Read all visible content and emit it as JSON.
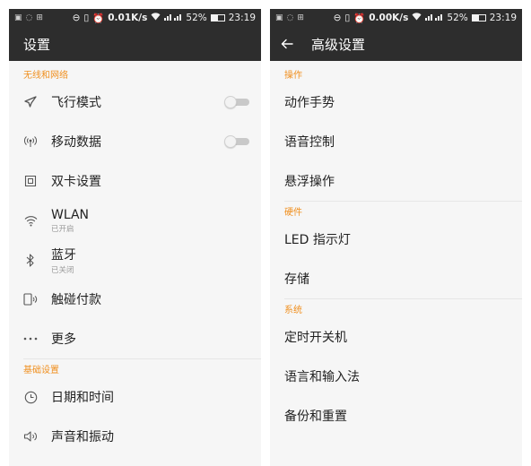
{
  "left": {
    "status": {
      "speed": "0.01K/s",
      "battery": "52%",
      "time": "23:19",
      "battery_level": 0.52
    },
    "title": "设置",
    "sections": {
      "wireless": {
        "header": "无线和网络"
      },
      "basic": {
        "header": "基础设置"
      }
    },
    "items": {
      "airplane": {
        "label": "飞行模式",
        "toggle_on": false
      },
      "mobile_data": {
        "label": "移动数据",
        "toggle_on": false
      },
      "dual_sim": {
        "label": "双卡设置"
      },
      "wlan": {
        "label": "WLAN",
        "sub": "已开启"
      },
      "bluetooth": {
        "label": "蓝牙",
        "sub": "已关闭"
      },
      "tap_pay": {
        "label": "触碰付款"
      },
      "more": {
        "label": "更多"
      },
      "date_time": {
        "label": "日期和时间"
      },
      "sound": {
        "label": "声音和振动"
      }
    },
    "icons": [
      "airplane-icon",
      "signal-tower-icon",
      "sim-card-icon",
      "wifi-icon",
      "bluetooth-icon",
      "nfc-phone-icon",
      "more-dots-icon",
      "clock-icon",
      "speaker-icon"
    ]
  },
  "right": {
    "status": {
      "speed": "0.00K/s",
      "battery": "52%",
      "time": "23:19",
      "battery_level": 0.52
    },
    "title": "高级设置",
    "sections": {
      "operation": {
        "header": "操作"
      },
      "hardware": {
        "header": "硬件"
      },
      "system": {
        "header": "系统"
      }
    },
    "items": {
      "gestures": {
        "label": "动作手势"
      },
      "voice": {
        "label": "语音控制"
      },
      "float": {
        "label": "悬浮操作"
      },
      "led": {
        "label": "LED 指示灯"
      },
      "storage": {
        "label": "存储"
      },
      "schedule_power": {
        "label": "定时开关机"
      },
      "language": {
        "label": "语言和输入法"
      },
      "backup": {
        "label": "备份和重置"
      }
    }
  },
  "colors": {
    "appbar": "#2d2d2d",
    "section_header": "#f09020",
    "background": "#f6f6f6"
  }
}
